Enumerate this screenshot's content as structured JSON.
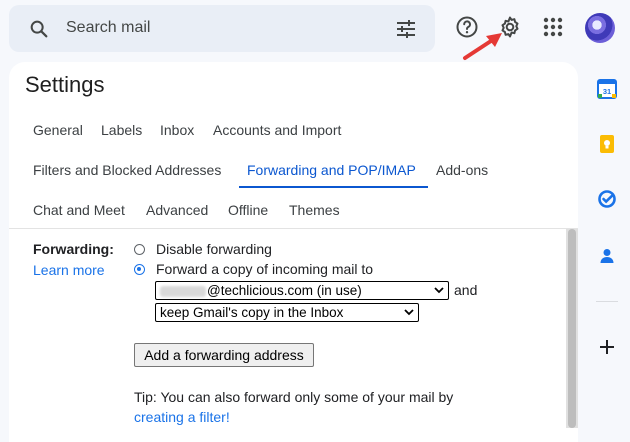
{
  "search": {
    "placeholder": "Search mail"
  },
  "settings": {
    "title": "Settings",
    "tabs_row1": [
      "General",
      "Labels",
      "Inbox",
      "Accounts and Import"
    ],
    "tabs_row2": [
      "Filters and Blocked Addresses",
      "Forwarding and POP/IMAP",
      "Add-ons"
    ],
    "tabs_row3": [
      "Chat and Meet",
      "Advanced",
      "Offline",
      "Themes"
    ],
    "active_tab": "Forwarding and POP/IMAP"
  },
  "forwarding": {
    "label": "Forwarding:",
    "learn_more": "Learn more",
    "options": [
      "Disable forwarding",
      "Forward a copy of incoming mail to"
    ],
    "selected_option": "Forward a copy of incoming mail to",
    "address_redacted": "suzanne",
    "address_select": "@techlicious.com (in use)",
    "and_text": "and",
    "action_select": "keep Gmail's copy in the Inbox",
    "add_button": "Add a forwarding address",
    "tip": "Tip: You can also forward only some of your mail by",
    "tip_link": "creating a filter!"
  },
  "colors": {
    "accent": "#0b57d0",
    "link": "#1a73e8",
    "arrow": "#e53935",
    "calendar": "#1a73e8",
    "keep": "#fbbc04",
    "tasks": "#1a73e8",
    "contacts": "#1a73e8"
  },
  "icons": [
    "search-icon",
    "tune-icon",
    "help-icon",
    "gear-icon",
    "apps-icon",
    "calendar-icon",
    "keep-icon",
    "tasks-icon",
    "contacts-icon",
    "add-icon"
  ]
}
